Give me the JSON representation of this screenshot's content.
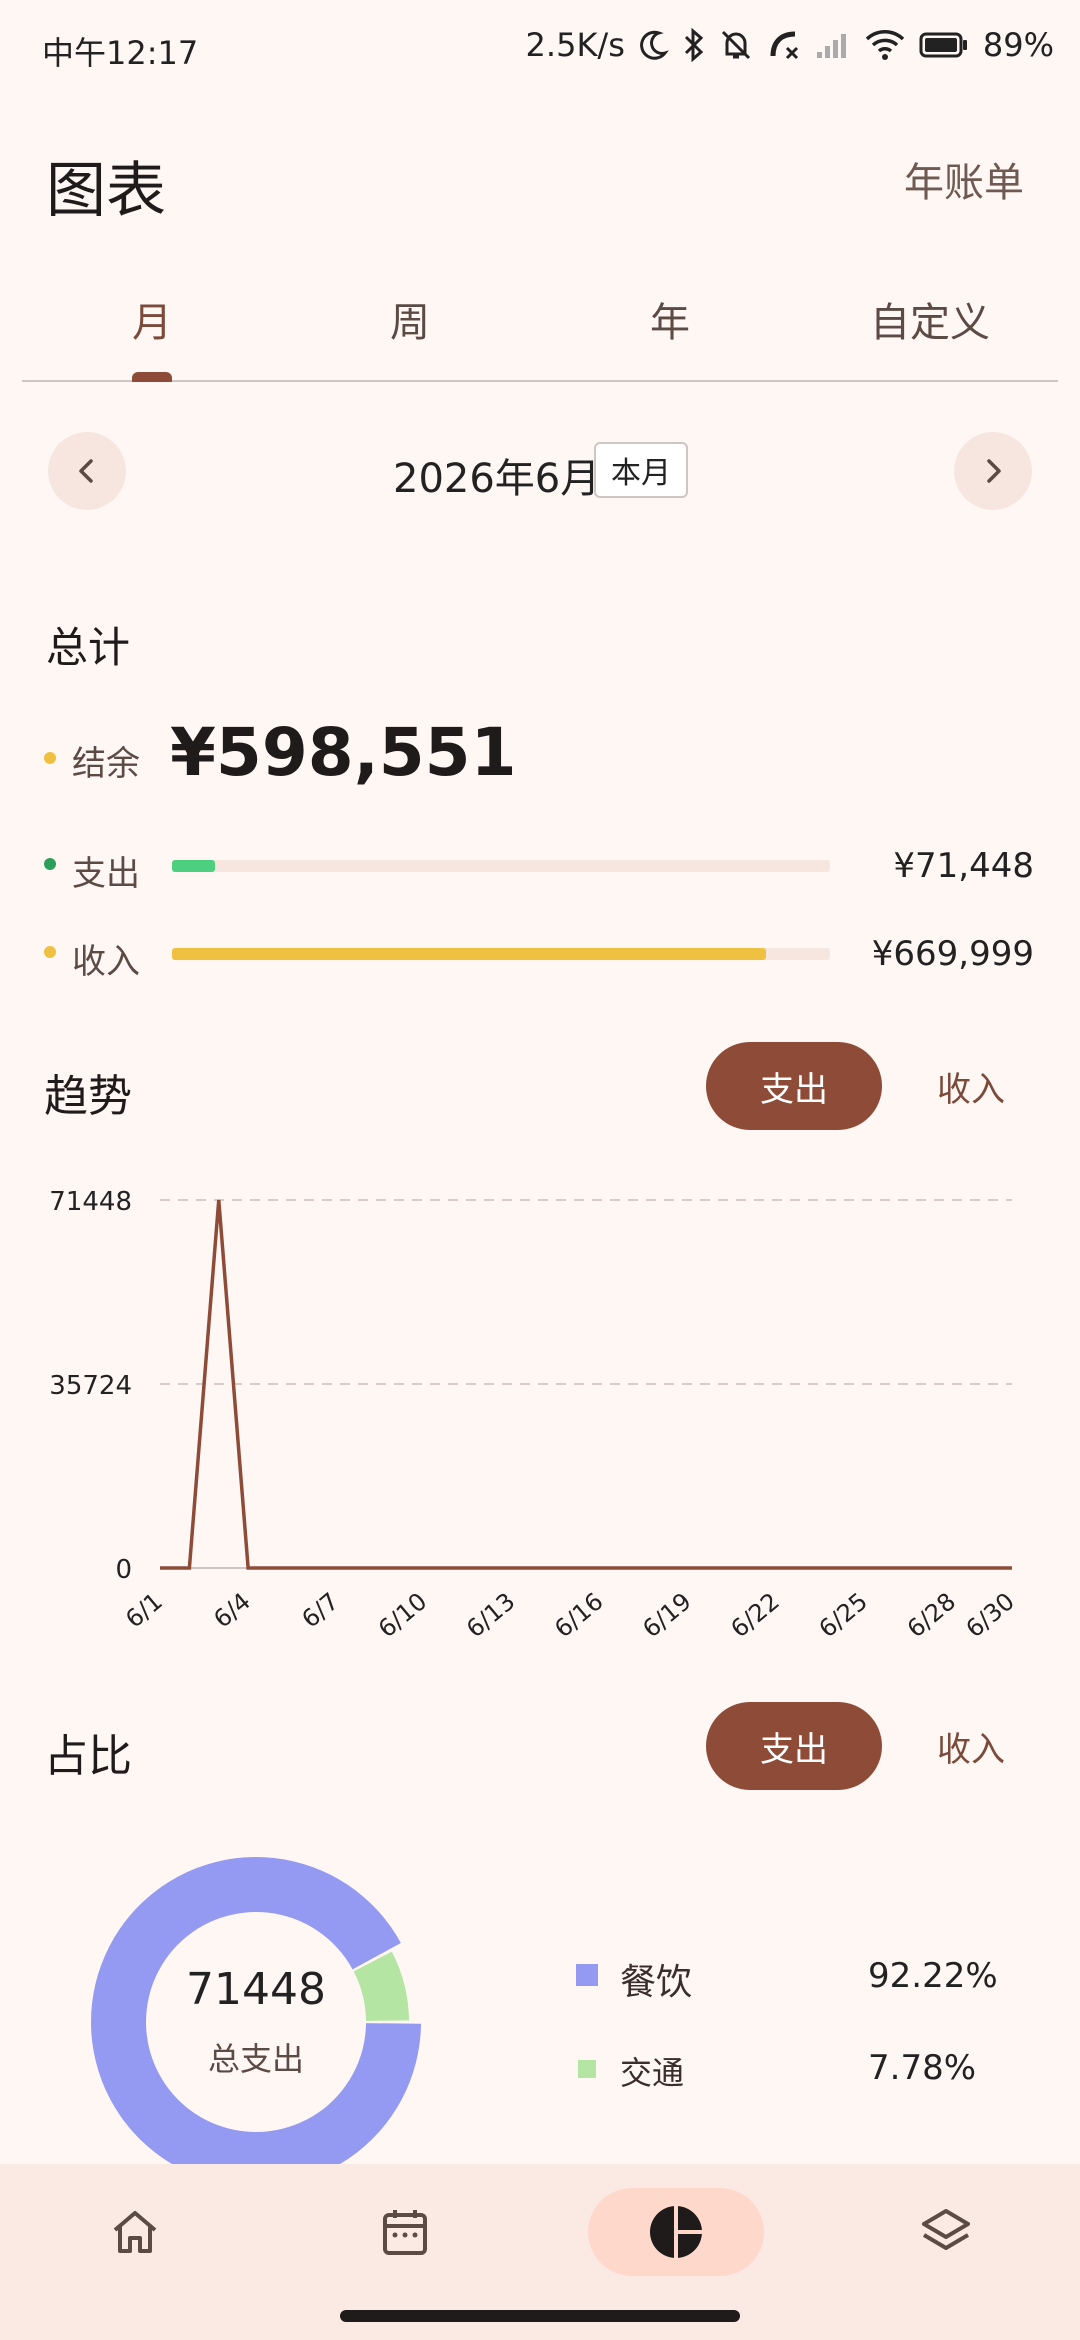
{
  "status_bar": {
    "time": "中午12:17",
    "net_speed": "2.5K/s",
    "battery": "89%"
  },
  "header": {
    "title": "图表",
    "annual_bill": "年账单"
  },
  "tabs": [
    {
      "label": "月",
      "active": true
    },
    {
      "label": "周",
      "active": false
    },
    {
      "label": "年",
      "active": false
    },
    {
      "label": "自定义",
      "active": false
    }
  ],
  "period": {
    "label": "2026年6月",
    "this_month": "本月"
  },
  "totals": {
    "heading": "总计",
    "balance_label": "结余",
    "balance_value": "¥598,551",
    "expense_label": "支出",
    "expense_value": "¥71,448",
    "expense_fraction": 0.0656,
    "income_label": "收入",
    "income_value": "¥669,999",
    "income_fraction": 0.902
  },
  "trend": {
    "heading": "趋势",
    "expense_btn": "支出",
    "income_btn": "收入"
  },
  "chart_data": {
    "type": "line",
    "x": [
      "6/1",
      "6/2",
      "6/3",
      "6/4",
      "6/5",
      "6/6",
      "6/7",
      "6/8",
      "6/9",
      "6/10",
      "6/11",
      "6/12",
      "6/13",
      "6/14",
      "6/15",
      "6/16",
      "6/17",
      "6/18",
      "6/19",
      "6/20",
      "6/21",
      "6/22",
      "6/23",
      "6/24",
      "6/25",
      "6/26",
      "6/27",
      "6/28",
      "6/29",
      "6/30"
    ],
    "x_tick_labels": [
      "6/1",
      "6/4",
      "6/7",
      "6/10",
      "6/13",
      "6/16",
      "6/19",
      "6/22",
      "6/25",
      "6/28",
      "6/30"
    ],
    "y_tick_labels": [
      "0",
      "35724",
      "71448"
    ],
    "values": [
      0,
      0,
      71448,
      0,
      0,
      0,
      0,
      0,
      0,
      0,
      0,
      0,
      0,
      0,
      0,
      0,
      0,
      0,
      0,
      0,
      0,
      0,
      0,
      0,
      0,
      0,
      0,
      0,
      0,
      0
    ],
    "ylim": [
      0,
      71448
    ],
    "grid": true,
    "color": "#8E4B38"
  },
  "share": {
    "heading": "占比",
    "expense_btn": "支出",
    "income_btn": "收入",
    "total": "71448",
    "caption": "总支出",
    "items": [
      {
        "name": "餐饮",
        "percent": "92.22%",
        "value": 92.22,
        "color": "#9499F2"
      },
      {
        "name": "交通",
        "percent": "7.78%",
        "value": 7.78,
        "color": "#B5E5A2"
      }
    ]
  },
  "colors": {
    "accent": "#8E4B38",
    "expense_dot": "#2E9E5B",
    "expense_bar": "#4CD080",
    "income": "#F0C040"
  },
  "bottom_nav": [
    {
      "icon": "home-icon",
      "active": false
    },
    {
      "icon": "calendar-icon",
      "active": false
    },
    {
      "icon": "pie-chart-icon",
      "active": true
    },
    {
      "icon": "layers-icon",
      "active": false
    }
  ]
}
